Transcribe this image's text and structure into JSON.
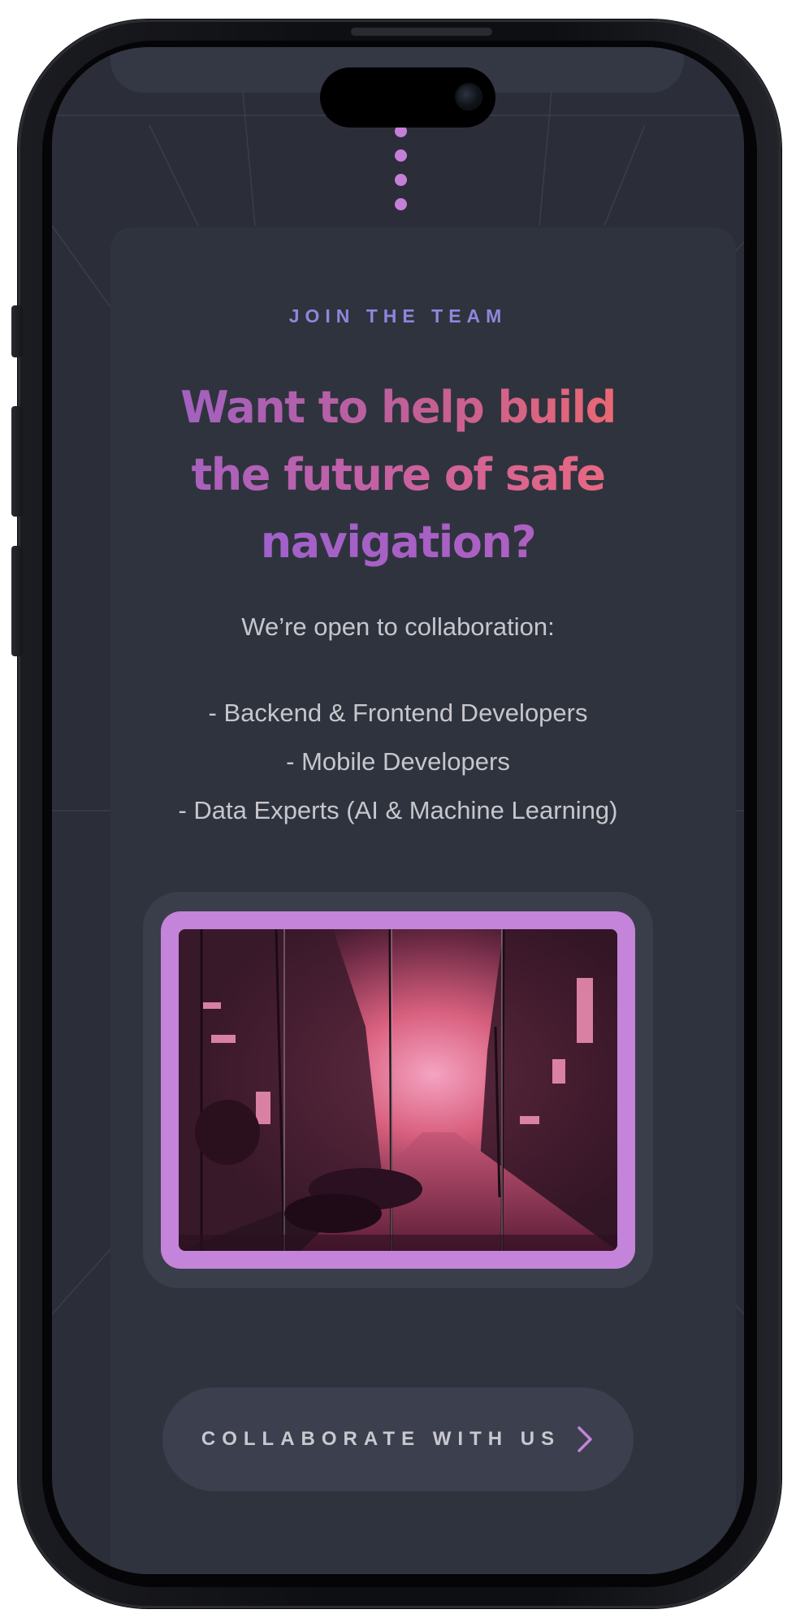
{
  "section": {
    "eyebrow": "JOIN THE TEAM",
    "headline": [
      "Want to help build",
      "the future of safe",
      "navigation?"
    ],
    "intro": "We’re open to collaboration:",
    "roles": [
      "- Backend & Frontend Developers",
      "- Mobile Developers",
      "- Data Experts (AI & Machine Learning)"
    ],
    "cta": {
      "label": "COLLABORATE WITH US",
      "icon": "chevron-right-icon"
    }
  },
  "colors": {
    "background": "#2b2e38",
    "card": "#2f333e",
    "accent": "#c384d9",
    "eyebrow": "#8d87dc",
    "headline_start": "#9b62c9",
    "headline_end": "#f46a6b",
    "body_text": "#c6c6cc",
    "button": "#3c3f4d"
  },
  "media": {
    "description": "neon-city-street-illustration"
  }
}
